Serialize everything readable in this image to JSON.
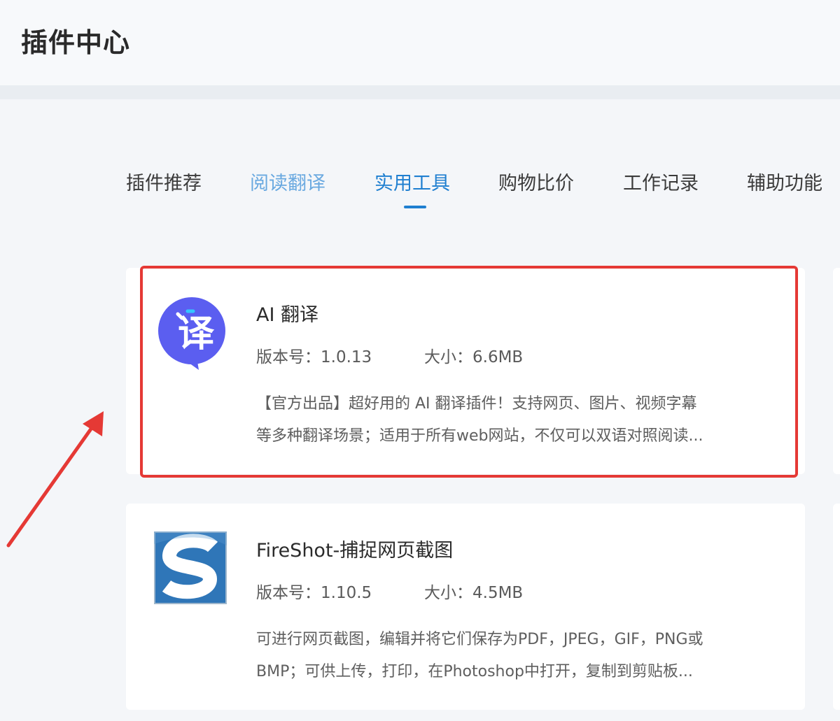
{
  "header": {
    "title": "插件中心"
  },
  "tabs": [
    {
      "label": "插件推荐"
    },
    {
      "label": "阅读翻译"
    },
    {
      "label": "实用工具"
    },
    {
      "label": "购物比价"
    },
    {
      "label": "工作记录"
    },
    {
      "label": "辅助功能"
    }
  ],
  "active_tab": "实用工具",
  "colors": {
    "accent": "#1f7fd0",
    "highlight": "#e53935",
    "translate_icon_bg": "#5b5ef0",
    "fireshot_blue": "#2f76b8"
  },
  "plugins": [
    {
      "name": "AI 翻译",
      "version_label": "版本号：",
      "version": "1.0.13",
      "size_label": "大小：",
      "size": "6.6MB",
      "description_line1": "【官方出品】超好用的 AI 翻译插件！支持网页、图片、视频字幕",
      "description_line2": "等多种翻译场景；适用于所有web网站，不仅可以双语对照阅读...",
      "icon": "translate-icon",
      "icon_glyph": "译"
    },
    {
      "name": "FireShot-捕捉网页截图",
      "version_label": "版本号：",
      "version": "1.10.5",
      "size_label": "大小：",
      "size": "4.5MB",
      "description_line1": "可进行网页截图，编辑并将它们保存为PDF，JPEG，GIF，PNG或",
      "description_line2": "BMP；可供上传，打印，在Photoshop中打开，复制到剪贴板...",
      "icon": "fireshot-icon"
    }
  ]
}
